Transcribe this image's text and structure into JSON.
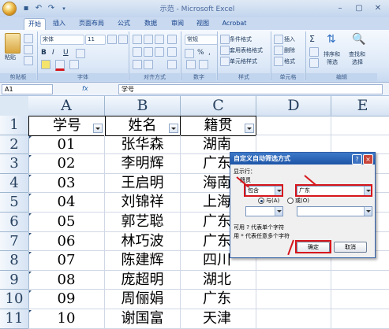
{
  "window": {
    "title": "示范 - Microsoft Excel"
  },
  "ribbon": {
    "tabs": [
      "开始",
      "插入",
      "页面布局",
      "公式",
      "数据",
      "审阅",
      "视图",
      "Acrobat"
    ],
    "active_tab": "开始",
    "font_name": "宋体",
    "font_size": "11",
    "number_format": "常规",
    "paste_label": "粘贴",
    "bold": "B",
    "italic": "I",
    "underline": "U",
    "percent": "%",
    "comma": ",",
    "cond_format": "条件格式",
    "table_format": "套用表格格式",
    "cell_style": "单元格样式",
    "insert": "插入",
    "delete": "删除",
    "format": "格式",
    "sum": "Σ",
    "sort_filter_line1": "排序和",
    "sort_filter_line2": "筛选",
    "find_select_line1": "查找和",
    "find_select_line2": "选择",
    "groups": [
      "剪贴板",
      "字体",
      "对齐方式",
      "数字",
      "样式",
      "单元格",
      "编辑"
    ]
  },
  "formula_bar": {
    "name_box": "A1",
    "fx": "fx",
    "content": "学号"
  },
  "sheet": {
    "columns": [
      "A",
      "B",
      "C",
      "D",
      "E"
    ],
    "rows": [
      "1",
      "2",
      "3",
      "4",
      "5",
      "6",
      "7",
      "8",
      "9",
      "10",
      "11"
    ],
    "headers": [
      "学号",
      "姓名",
      "籍贯"
    ],
    "data": [
      [
        "01",
        "张华森",
        "湖南"
      ],
      [
        "02",
        "李明辉",
        "广东"
      ],
      [
        "03",
        "王启明",
        "海南"
      ],
      [
        "04",
        "刘锦祥",
        "上海"
      ],
      [
        "05",
        "郭艺聪",
        "广东"
      ],
      [
        "06",
        "林巧波",
        "广东"
      ],
      [
        "07",
        "陈建辉",
        "四川"
      ],
      [
        "08",
        "庞超明",
        "湖北"
      ],
      [
        "09",
        "周俪娟",
        "广东"
      ],
      [
        "10",
        "谢国富",
        "天津"
      ]
    ]
  },
  "dialog": {
    "title": "自定义自动筛选方式",
    "show_rows": "显示行：",
    "field": "籍贯",
    "operator": "包含",
    "value": "广东",
    "and_label": "与(A)",
    "or_label": "或(O)",
    "hint1": "可用 ? 代表单个字符",
    "hint2": "用 * 代表任意多个字符",
    "ok": "确定",
    "cancel": "取消",
    "help": "?",
    "close": "×"
  },
  "colors": {
    "highlight": "#d6161c",
    "dialog_titlebar": "#1d54a6"
  }
}
